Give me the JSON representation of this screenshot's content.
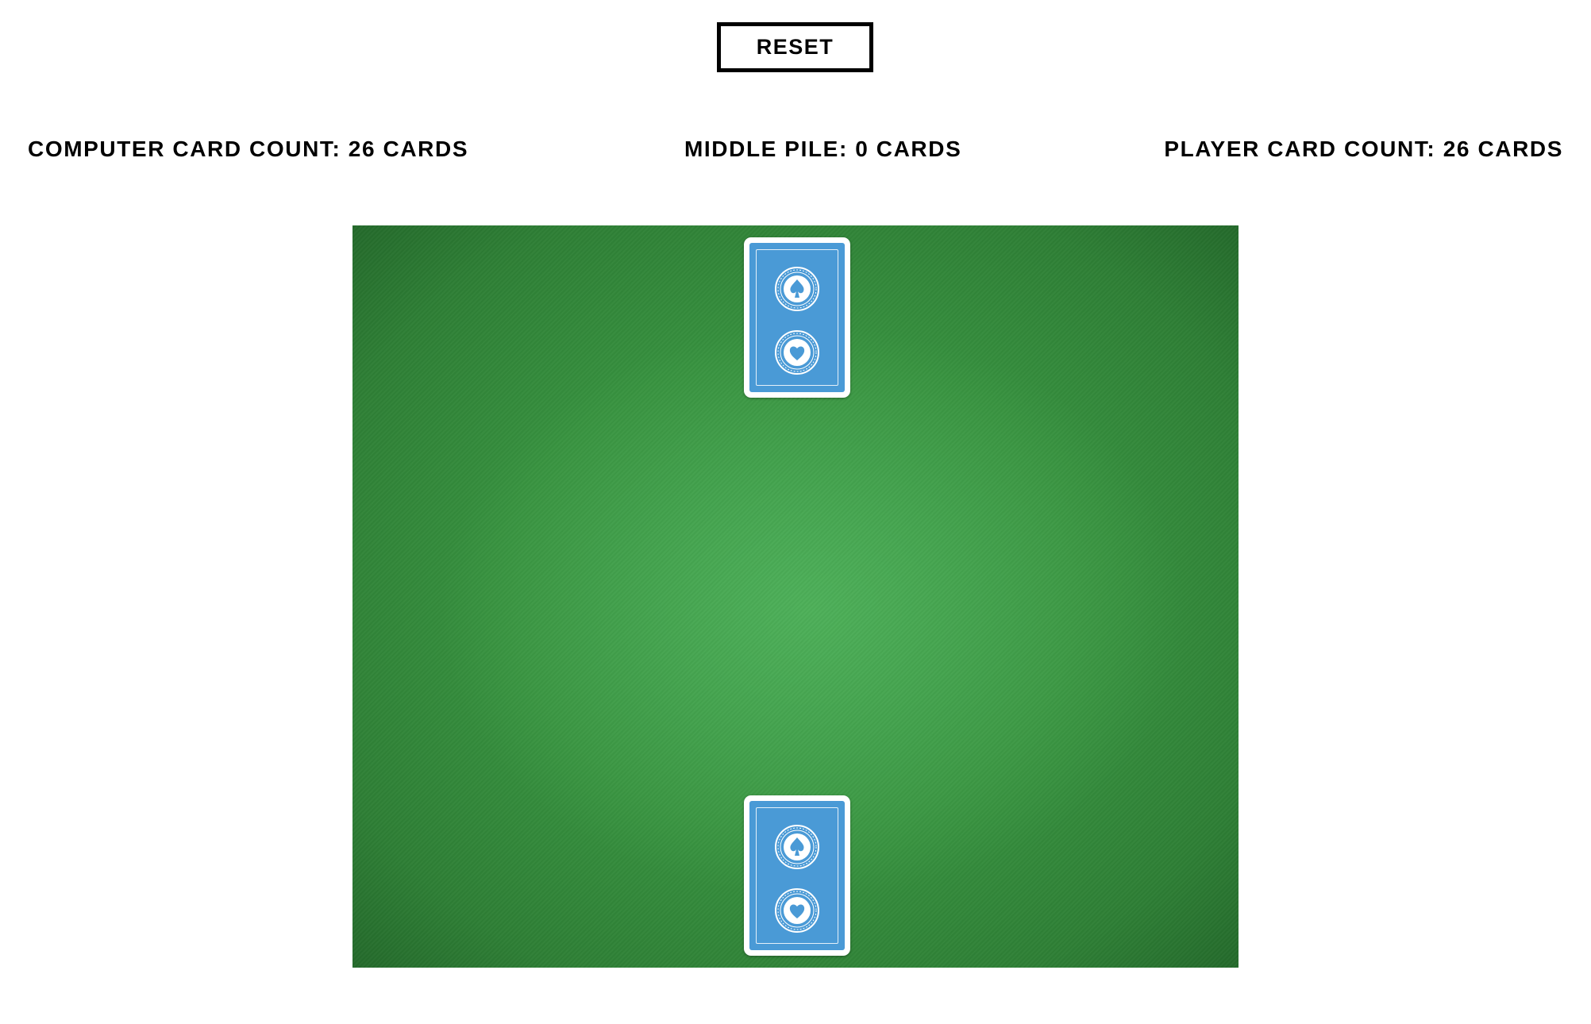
{
  "controls": {
    "reset_label": "RESET"
  },
  "counts": {
    "computer": "COMPUTER CARD COUNT: 26 CARDS",
    "middle": "MIDDLE PILE: 0 CARDS",
    "player": "PLAYER CARD COUNT: 26 CARDS"
  },
  "table": {
    "felt_color": "#37923f",
    "card_back_color": "#4a9ad6",
    "computer_card": "face-down",
    "player_card": "face-down"
  },
  "icons": {
    "card_emblem_top": "spade-emblem-icon",
    "card_emblem_bottom": "heart-emblem-icon"
  }
}
